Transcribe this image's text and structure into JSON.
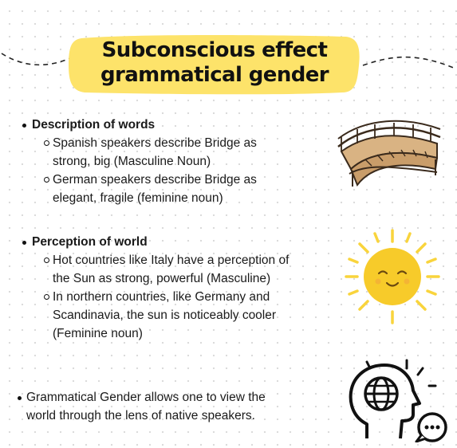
{
  "title": {
    "line1": "Subconscious effect",
    "line2": "grammatical gender"
  },
  "sections": [
    {
      "heading": "Description of words",
      "items": [
        {
          "line1": "Spanish speakers describe Bridge as",
          "line2": "strong, big (Masculine Noun)"
        },
        {
          "line1": "German speakers describe Bridge as",
          "line2": "elegant, fragile (feminine noun)"
        }
      ]
    },
    {
      "heading": "Perception of world",
      "items": [
        {
          "line1": "Hot countries like Italy have a perception of",
          "line2": "the Sun as strong, powerful (Masculine)"
        },
        {
          "line1": "In northern countries, like Germany and",
          "line2": "Scandinavia, the sun is noticeably cooler",
          "line3": "(Feminine noun)"
        }
      ]
    }
  ],
  "note": {
    "line1": "Grammatical Gender allows one to view the",
    "line2": "world through the lens of native speakers."
  },
  "icons": [
    "bridge-icon",
    "sun-icon",
    "head-globe-chat-icon"
  ],
  "colors": {
    "title_highlight": "#fde36a",
    "sun": "#f7cb2a",
    "sun_rays": "#f9d43c",
    "bridge_wood": "#d9b383",
    "bridge_outline": "#3a2a1c"
  }
}
